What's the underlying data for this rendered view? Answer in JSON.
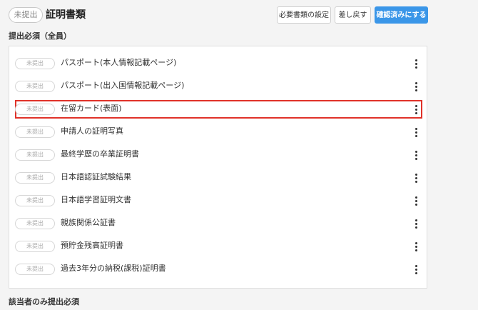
{
  "header": {
    "status": "未提出",
    "title": "証明書類",
    "buttons": {
      "settings": "必要書類の設定",
      "return": "差し戻す",
      "confirm": "確認済みにする"
    }
  },
  "sections": {
    "required_all": "提出必須（全員）",
    "required_applicable": "該当者のみ提出必須"
  },
  "documents": [
    {
      "status": "未提出",
      "name": "パスポート(本人情報記載ページ)"
    },
    {
      "status": "未提出",
      "name": "パスポート(出入国情報記載ページ)"
    },
    {
      "status": "未提出",
      "name": "在留カード(表面)"
    },
    {
      "status": "未提出",
      "name": "申請人の証明写真"
    },
    {
      "status": "未提出",
      "name": "最終学歴の卒業証明書"
    },
    {
      "status": "未提出",
      "name": "日本語認証試験結果"
    },
    {
      "status": "未提出",
      "name": "日本語学習証明文書"
    },
    {
      "status": "未提出",
      "name": "親族関係公証書"
    },
    {
      "status": "未提出",
      "name": "預貯金残高証明書"
    },
    {
      "status": "未提出",
      "name": "過去3年分の納税(課税)証明書"
    }
  ],
  "colors": {
    "primary": "#3a96e8",
    "highlight": "#e03229"
  },
  "icons": {
    "row_menu": "kebab-menu-icon"
  }
}
